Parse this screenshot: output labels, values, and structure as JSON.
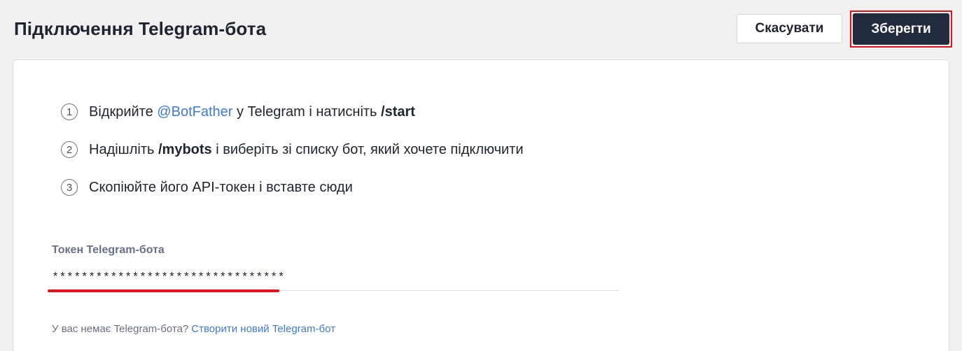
{
  "header": {
    "title": "Підключення Telegram-бота",
    "cancel_label": "Скасувати",
    "save_label": "Зберегти"
  },
  "steps": [
    {
      "num": "1",
      "text_before": "Відкрийте ",
      "link": "@BotFather",
      "text_middle": " у Telegram і натисніть ",
      "strong": "/start"
    },
    {
      "num": "2",
      "text_before": "Надішліть ",
      "strong": "/mybots",
      "text_after": " і виберіть зі списку бот, який хочете підключити"
    },
    {
      "num": "3",
      "text": "Скопіюйте його API-токен і вставте сюди"
    }
  ],
  "token_field": {
    "label": "Токен Telegram-бота",
    "value": "********************************"
  },
  "footer": {
    "question": "У вас немає Telegram-бота?",
    "create_link": "Створити новий Telegram-бот"
  },
  "colors": {
    "background": "#f1f1f1",
    "primary_button": "#222a3d",
    "link": "#3f7bd1",
    "highlight_red": "#e0121b"
  }
}
